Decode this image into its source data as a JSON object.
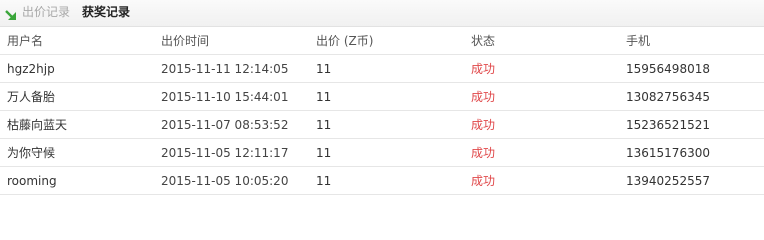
{
  "tabs": {
    "icon": "green-arrow-icon",
    "inactive_label": "出价记录",
    "active_label": "获奖记录"
  },
  "table": {
    "columns": [
      "用户名",
      "出价时间",
      "出价 (Z币)",
      "状态",
      "手机"
    ],
    "rows": [
      [
        "hgz2hjp",
        "2015-11-11 12:14:05",
        "11",
        "成功",
        "15956498018"
      ],
      [
        "万人备胎",
        "2015-11-10 15:44:01",
        "11",
        "成功",
        "13082756345"
      ],
      [
        "枯藤向蓝天",
        "2015-11-07 08:53:52",
        "11",
        "成功",
        "15236521521"
      ],
      [
        "为你守候",
        "2015-11-05 12:11:17",
        "11",
        "成功",
        "13615176300"
      ],
      [
        "rooming",
        "2015-11-05 10:05:20",
        "11",
        "成功",
        "13940252557"
      ]
    ]
  },
  "colors": {
    "status_success": "#e0484a",
    "icon_green": "#3aa63a"
  }
}
